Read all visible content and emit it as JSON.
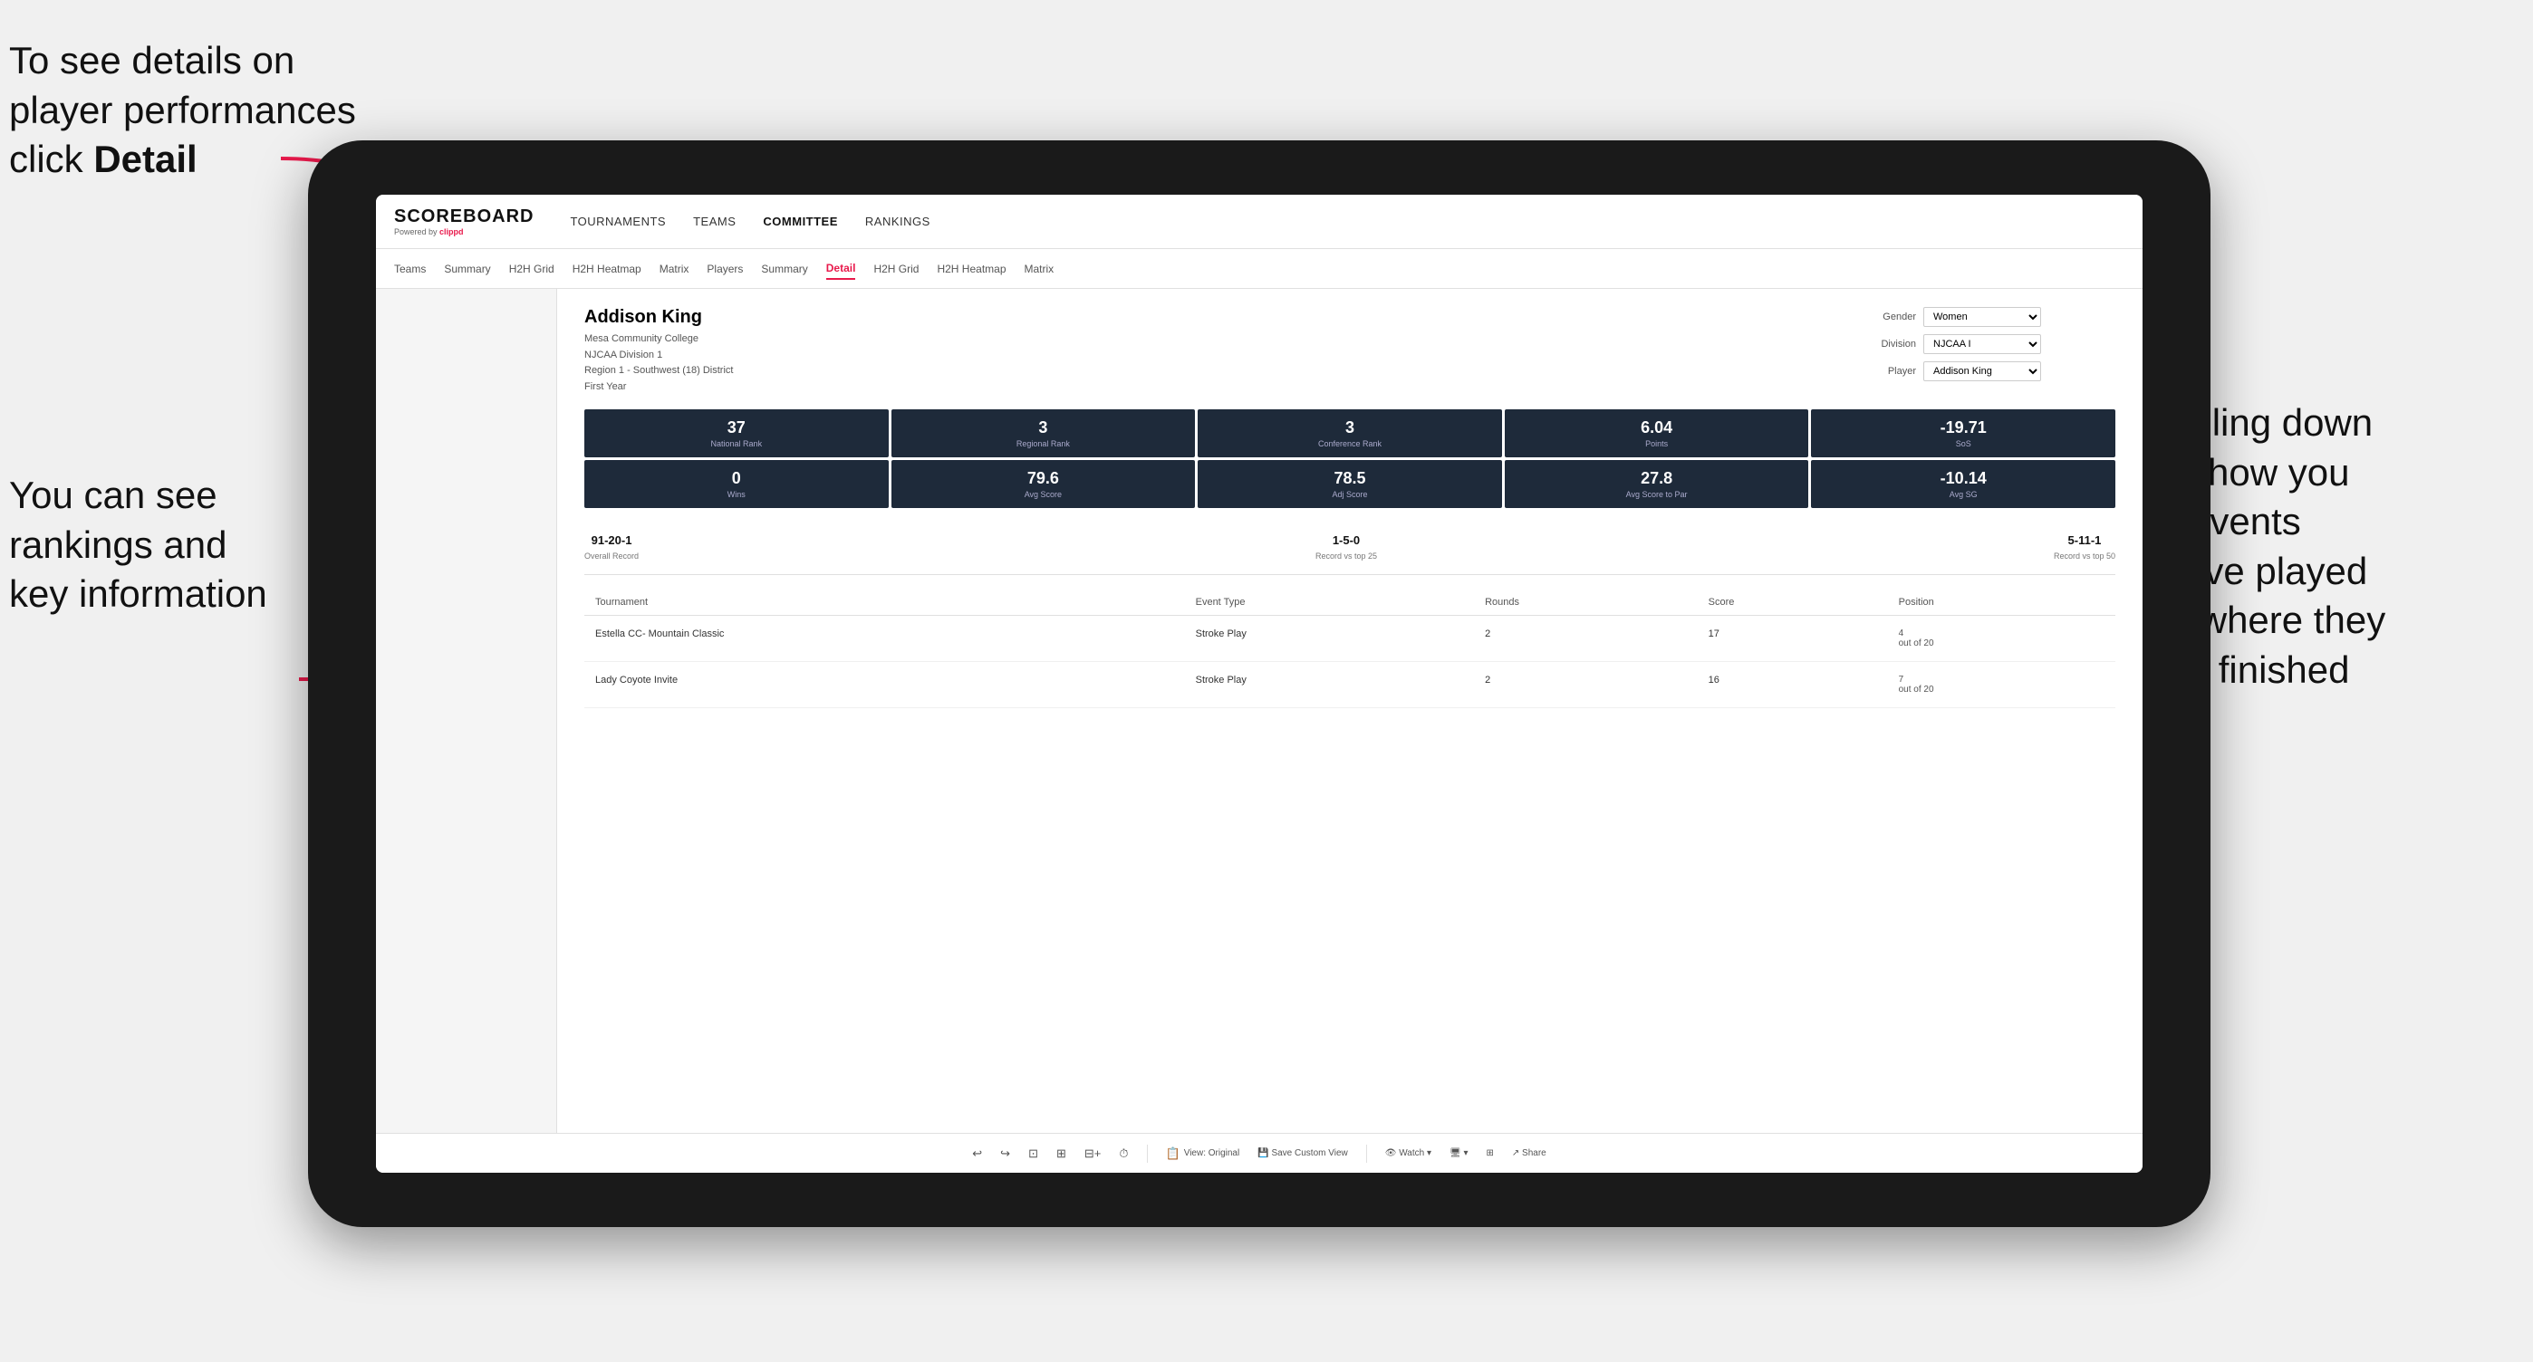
{
  "annotations": {
    "top_left": {
      "line1": "To see details on",
      "line2": "player performances",
      "line3_prefix": "click ",
      "line3_bold": "Detail"
    },
    "bottom_left": {
      "line1": "You can see",
      "line2": "rankings and",
      "line3": "key information"
    },
    "right": {
      "line1": "Scrolling down",
      "line2": "will show you",
      "line3": "the events",
      "line4": "they've played",
      "line5": "and where they",
      "line6": "have finished"
    }
  },
  "nav": {
    "logo": "SCOREBOARD",
    "logo_sub": "Powered by clippd",
    "items": [
      "TOURNAMENTS",
      "TEAMS",
      "COMMITTEE",
      "RANKINGS"
    ]
  },
  "sub_nav": {
    "items": [
      "Teams",
      "Summary",
      "H2H Grid",
      "H2H Heatmap",
      "Matrix",
      "Players",
      "Summary",
      "Detail",
      "H2H Grid",
      "H2H Heatmap",
      "Matrix"
    ],
    "active": "Detail"
  },
  "player": {
    "name": "Addison King",
    "school": "Mesa Community College",
    "division": "NJCAA Division 1",
    "region": "Region 1 - Southwest (18) District",
    "year": "First Year"
  },
  "controls": {
    "gender_label": "Gender",
    "gender_value": "Women",
    "division_label": "Division",
    "division_value": "NJCAA I",
    "player_label": "Player",
    "player_value": "Addison King"
  },
  "stats_row1": [
    {
      "value": "37",
      "label": "National Rank"
    },
    {
      "value": "3",
      "label": "Regional Rank"
    },
    {
      "value": "3",
      "label": "Conference Rank"
    },
    {
      "value": "6.04",
      "label": "Points"
    },
    {
      "value": "-19.71",
      "label": "SoS"
    }
  ],
  "stats_row2": [
    {
      "value": "0",
      "label": "Wins"
    },
    {
      "value": "79.6",
      "label": "Avg Score"
    },
    {
      "value": "78.5",
      "label": "Adj Score"
    },
    {
      "value": "27.8",
      "label": "Avg Score to Par"
    },
    {
      "value": "-10.14",
      "label": "Avg SG"
    }
  ],
  "records": [
    {
      "value": "91-20-1",
      "label": "Overall Record"
    },
    {
      "value": "1-5-0",
      "label": "Record vs top 25"
    },
    {
      "value": "5-11-1",
      "label": "Record vs top 50"
    }
  ],
  "table": {
    "headers": [
      "Tournament",
      "Event Type",
      "Rounds",
      "Score",
      "Position"
    ],
    "rows": [
      {
        "tournament": "Estella CC- Mountain Classic",
        "event_type": "Stroke Play",
        "rounds": "2",
        "score": "17",
        "position": "4\nout of 20"
      },
      {
        "tournament": "Lady Coyote Invite",
        "event_type": "Stroke Play",
        "rounds": "2",
        "score": "16",
        "position": "7\nout of 20"
      }
    ]
  },
  "toolbar": {
    "items": [
      "↩",
      "↪",
      "⊡",
      "⊞",
      "⊟-+",
      "⏱",
      "View: Original",
      "Save Custom View",
      "👁 Watch ▾",
      "🖥 ▾",
      "⊞",
      "Share"
    ]
  }
}
